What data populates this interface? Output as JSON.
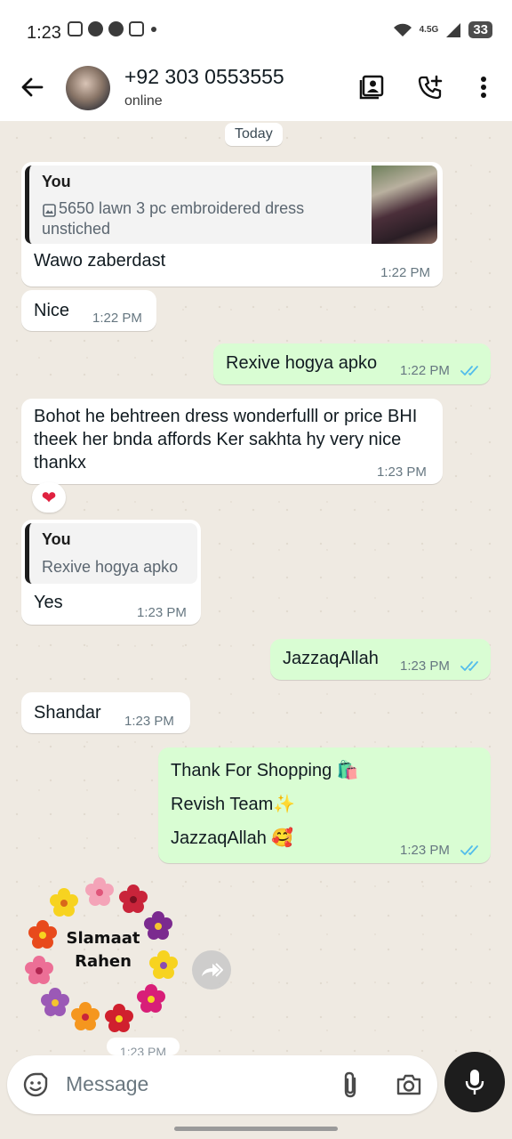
{
  "status_bar": {
    "time": "1:23",
    "network": "4.5G",
    "battery": "33"
  },
  "header": {
    "contact_name": "+92 303 0553555",
    "contact_status": "online"
  },
  "date_label": "Today",
  "messages": [
    {
      "direction": "in",
      "quote_author": "You",
      "quote_text": "5650 lawn 3 pc embroidered dress unstiched",
      "text": "Wawo zaberdast",
      "time": "1:22 PM"
    },
    {
      "direction": "in",
      "text": "Nice",
      "time": "1:22 PM"
    },
    {
      "direction": "out",
      "text": "Rexive hogya apko",
      "time": "1:22 PM"
    },
    {
      "direction": "in",
      "text": "Bohot he behtreen dress wonderfulll or price BHI theek her bnda affords Ker sakhta hy very nice thankx",
      "time": "1:23 PM",
      "reaction": "❤"
    },
    {
      "direction": "in",
      "quote_author": "You",
      "quote_text": "Rexive hogya apko",
      "text": "Yes",
      "time": "1:23 PM"
    },
    {
      "direction": "out",
      "text": "JazzaqAllah",
      "time": "1:23 PM"
    },
    {
      "direction": "in",
      "text": "Shandar",
      "time": "1:23 PM"
    },
    {
      "direction": "out",
      "lines": [
        "Thank For  Shopping 🛍️",
        "Revish  Team✨",
        "JazzaqAllah 🥰"
      ],
      "time": "1:23 PM"
    }
  ],
  "sticker": {
    "line1": "Slamaat",
    "line2": "Rahen",
    "time": "1:23 PM"
  },
  "composer": {
    "placeholder": "Message"
  },
  "colors": {
    "incoming": "#ffffff",
    "outgoing": "#d9fdd3",
    "read_ticks": "#53bdeb",
    "wallpaper": "#efeae2"
  }
}
